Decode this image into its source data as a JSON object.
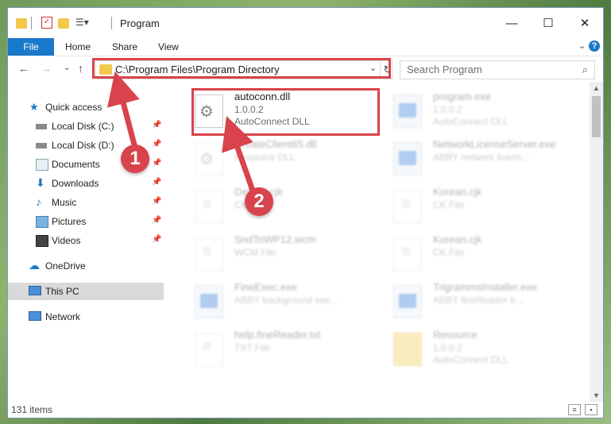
{
  "window": {
    "title": "Program"
  },
  "ribbon": {
    "tabs": [
      "File",
      "Home",
      "Share",
      "View"
    ]
  },
  "navigation": {
    "address": "C:\\Program Files\\Program Directory",
    "search_placeholder": "Search Program"
  },
  "sidebar": {
    "items": [
      {
        "label": "Quick access",
        "icon": "star-icon"
      },
      {
        "label": "Local Disk (C:)",
        "icon": "drive-icon",
        "pinned": true
      },
      {
        "label": "Local Disk (D:)",
        "icon": "drive-icon",
        "pinned": true
      },
      {
        "label": "Documents",
        "icon": "documents-icon",
        "pinned": true
      },
      {
        "label": "Downloads",
        "icon": "download-icon",
        "pinned": true
      },
      {
        "label": "Music",
        "icon": "music-icon",
        "pinned": true
      },
      {
        "label": "Pictures",
        "icon": "pictures-icon",
        "pinned": true
      },
      {
        "label": "Videos",
        "icon": "videos-icon",
        "pinned": true
      },
      {
        "label": "OneDrive",
        "icon": "cloud-icon"
      },
      {
        "label": "This PC",
        "icon": "computer-icon",
        "selected": true
      },
      {
        "label": "Network",
        "icon": "network-icon"
      }
    ]
  },
  "files": [
    {
      "name": "autoconn.dll",
      "line2": "1.0.0.2",
      "line3": "AutoConnect DLL",
      "icon": "dll"
    },
    {
      "name": "program.exe",
      "line2": "1.0.0.2",
      "line3": "AutoConnect DLL",
      "icon": "exe"
    },
    {
      "name": "CreateClient65.dll",
      "line2": "Resource DLL",
      "line3": "",
      "icon": "dll"
    },
    {
      "name": "NetworkLicenseServer.exe",
      "line2": "ABBY network licens...",
      "line3": "",
      "icon": "exe"
    },
    {
      "name": "Default.cjk",
      "line2": "CK File",
      "line3": "",
      "icon": "txt"
    },
    {
      "name": "Korean.cjk",
      "line2": "CK File",
      "line3": "",
      "icon": "txt"
    },
    {
      "name": "SndToWP12.wcm",
      "line2": "WCM File",
      "line3": "",
      "icon": "txt"
    },
    {
      "name": "Korean.cjk",
      "line2": "CK File",
      "line3": "",
      "icon": "txt"
    },
    {
      "name": "FineExec.exe",
      "line2": "ABBY background exe...",
      "line3": "",
      "icon": "exe"
    },
    {
      "name": "TrigrammsInstaller.exe",
      "line2": "ABBY fineReader tr...",
      "line3": "",
      "icon": "exe"
    },
    {
      "name": "help.fineReader.txt",
      "line2": "TXT File",
      "line3": "",
      "icon": "txt"
    },
    {
      "name": "Resource",
      "line2": "1.0.0.2",
      "line3": "AutoConnect DLL",
      "icon": "folder"
    }
  ],
  "status": {
    "item_count": "131 items"
  },
  "annotations": {
    "step1": "1",
    "step2": "2"
  },
  "colors": {
    "accent": "#1979ca",
    "highlight": "#d9434b"
  }
}
